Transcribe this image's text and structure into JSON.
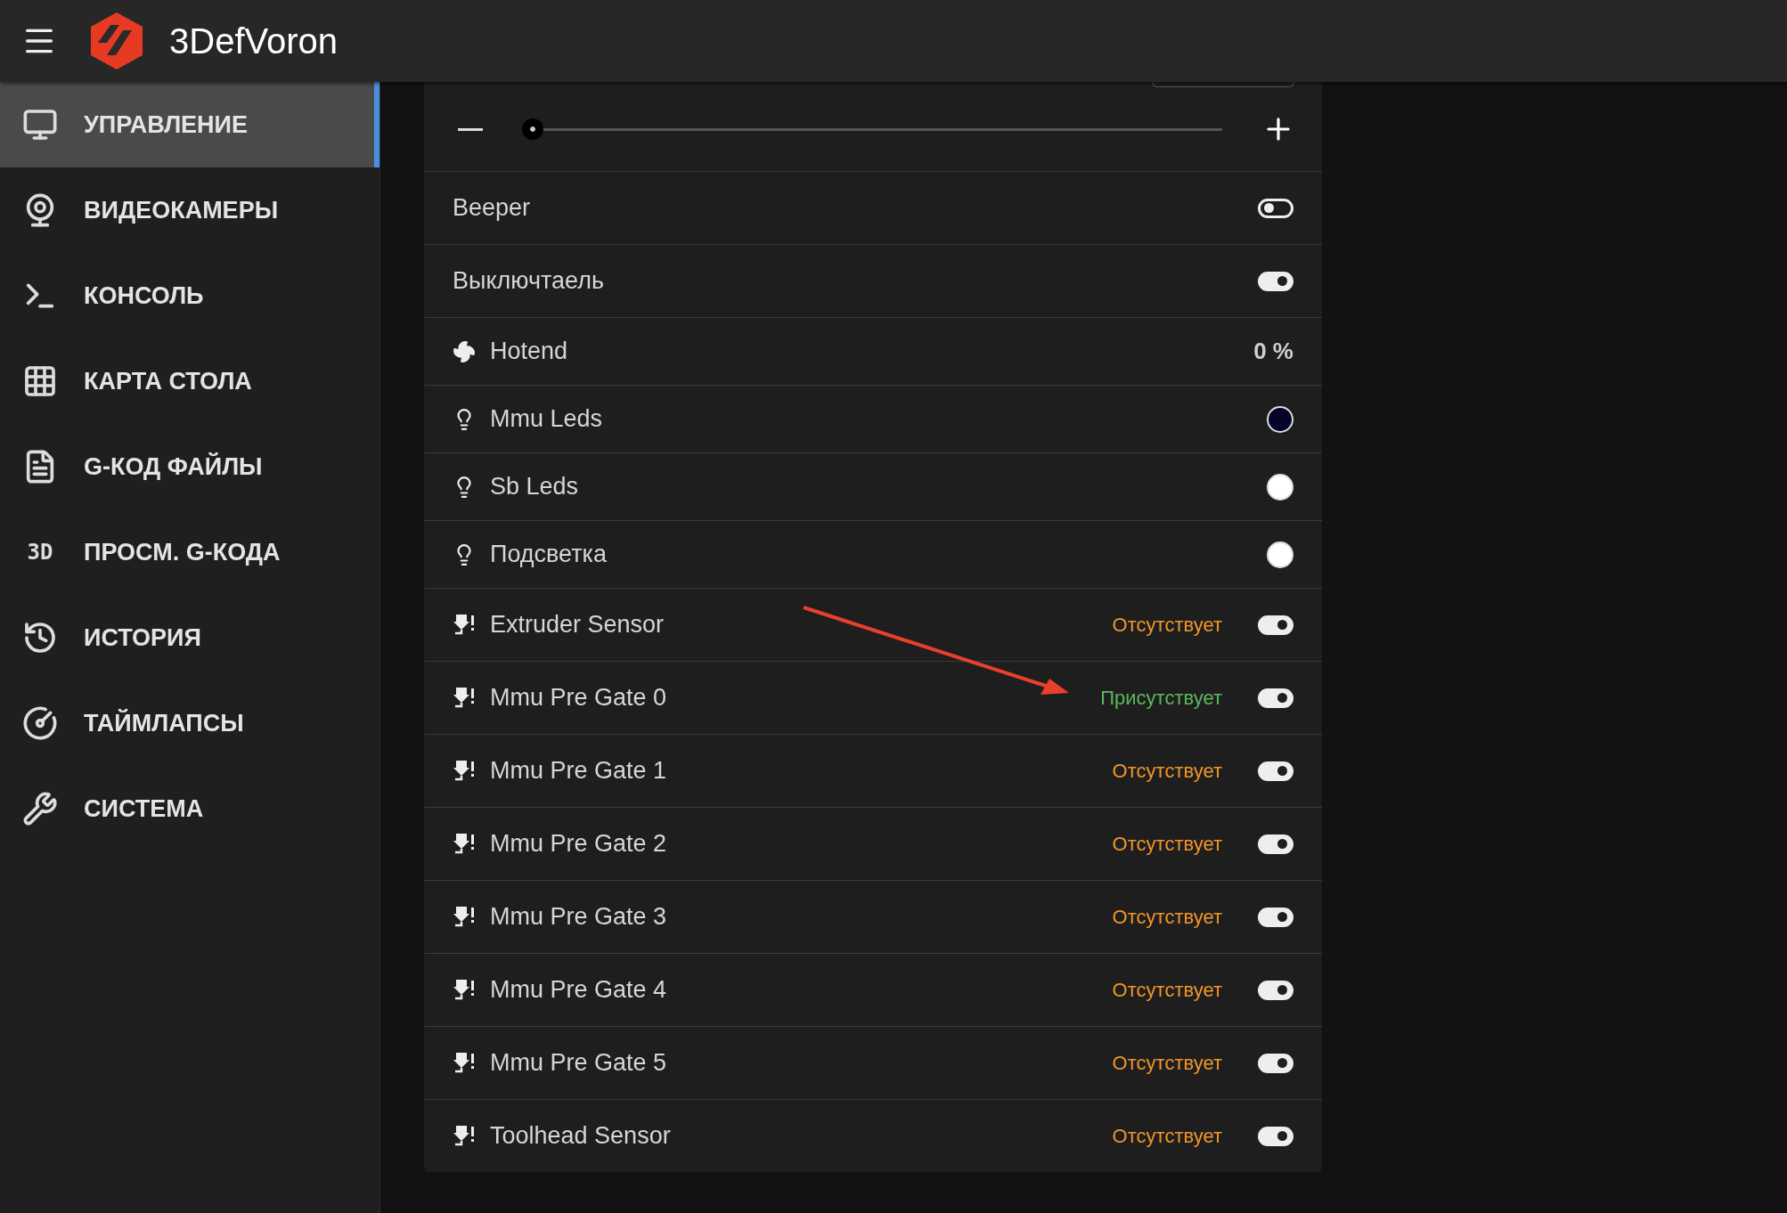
{
  "header": {
    "title": "3DefVoron"
  },
  "sidebar": {
    "items": [
      {
        "label": "УПРАВЛЕНИЕ",
        "selected": true
      },
      {
        "label": "ВИДЕОКАМЕРЫ",
        "selected": false
      },
      {
        "label": "КОНСОЛЬ",
        "selected": false
      },
      {
        "label": "КАРТА СТОЛА",
        "selected": false
      },
      {
        "label": "G-КОД ФАЙЛЫ",
        "selected": false
      },
      {
        "label": "ПРОСМ. G-КОДА",
        "icon_text": "3D",
        "selected": false
      },
      {
        "label": "ИСТОРИЯ",
        "selected": false
      },
      {
        "label": "ТАЙМЛАПСЫ",
        "selected": false
      },
      {
        "label": "СИСТЕМА",
        "selected": false
      }
    ]
  },
  "panel": {
    "slider": {
      "level": 0
    },
    "rows": [
      {
        "kind": "toggle",
        "label": "Beeper",
        "on": false
      },
      {
        "kind": "toggle",
        "label": "Выключтаель",
        "on": true
      },
      {
        "kind": "fan",
        "label": "Hotend",
        "reading": "0 %"
      },
      {
        "kind": "led",
        "label": "Mmu Leds",
        "color": "#05052a"
      },
      {
        "kind": "led",
        "label": "Sb Leds",
        "color": "#ffffff"
      },
      {
        "kind": "led",
        "label": "Подсветка",
        "color": "#ffffff"
      },
      {
        "kind": "sensor",
        "label": "Extruder Sensor",
        "status": "Отсутствует",
        "present": false,
        "on": true
      },
      {
        "kind": "sensor",
        "label": "Mmu Pre Gate 0",
        "status": "Присутствует",
        "present": true,
        "on": true
      },
      {
        "kind": "sensor",
        "label": "Mmu Pre Gate 1",
        "status": "Отсутствует",
        "present": false,
        "on": true
      },
      {
        "kind": "sensor",
        "label": "Mmu Pre Gate 2",
        "status": "Отсутствует",
        "present": false,
        "on": true
      },
      {
        "kind": "sensor",
        "label": "Mmu Pre Gate 3",
        "status": "Отсутствует",
        "present": false,
        "on": true
      },
      {
        "kind": "sensor",
        "label": "Mmu Pre Gate 4",
        "status": "Отсутствует",
        "present": false,
        "on": true
      },
      {
        "kind": "sensor",
        "label": "Mmu Pre Gate 5",
        "status": "Отсутствует",
        "present": false,
        "on": true
      },
      {
        "kind": "sensor",
        "label": "Toolhead Sensor",
        "status": "Отсутствует",
        "present": false,
        "on": true
      }
    ]
  }
}
